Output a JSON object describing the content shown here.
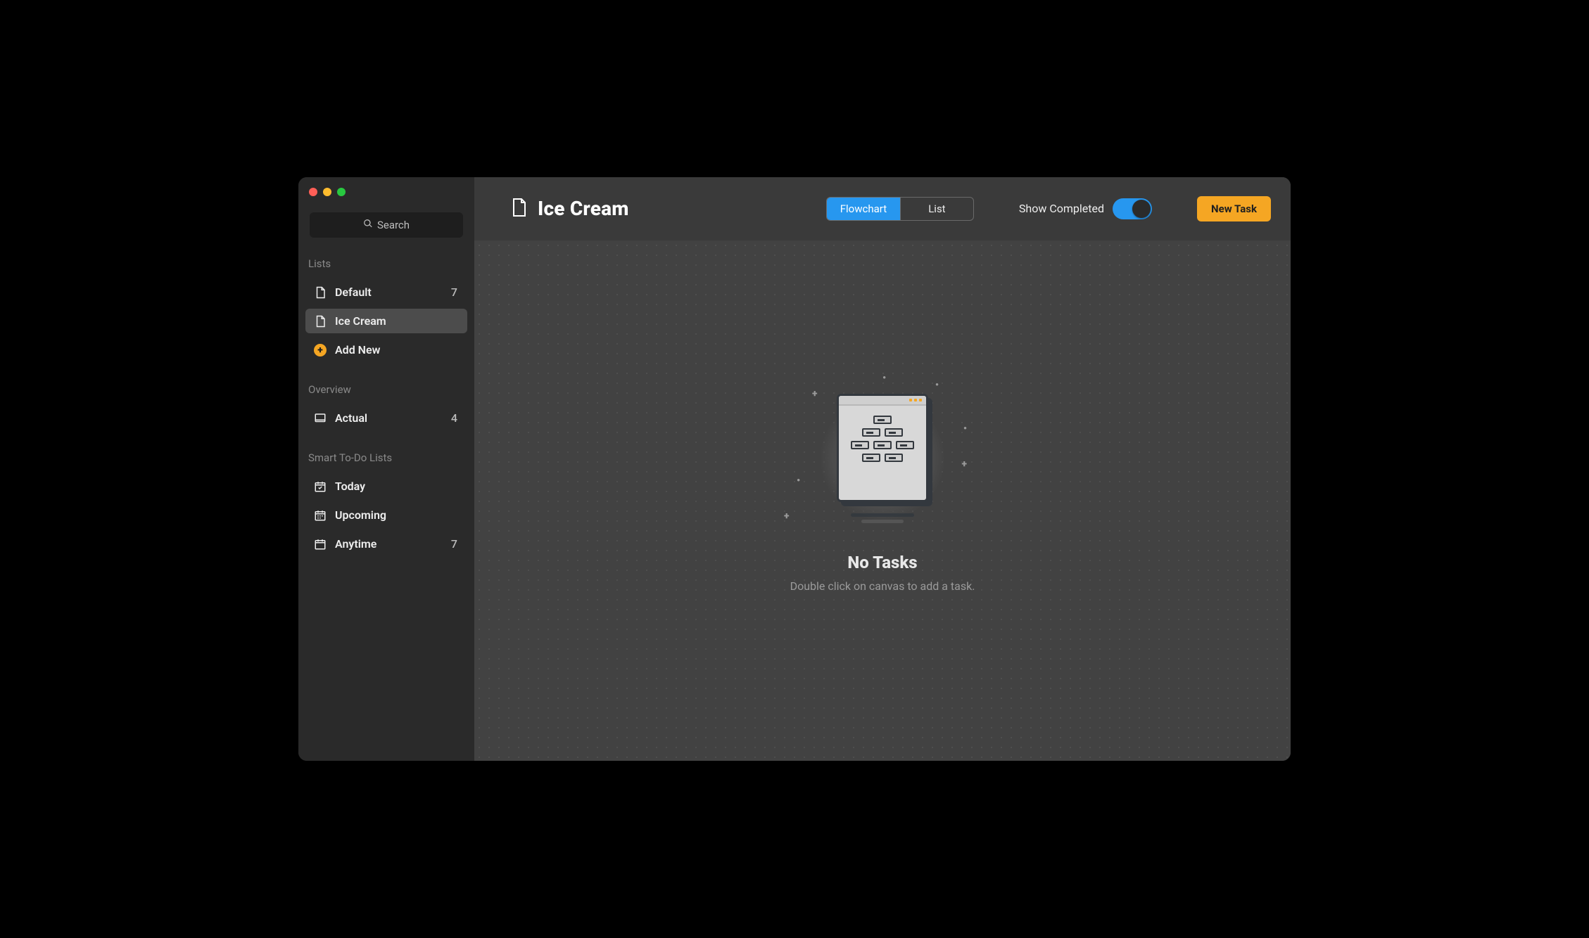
{
  "search": {
    "placeholder": "Search"
  },
  "sidebar": {
    "sections": {
      "lists": {
        "header": "Lists"
      },
      "overview": {
        "header": "Overview"
      },
      "smart": {
        "header": "Smart To-Do Lists"
      }
    },
    "lists": [
      {
        "label": "Default",
        "count": "7"
      },
      {
        "label": "Ice Cream",
        "count": ""
      }
    ],
    "add_new_label": "Add New",
    "overview": [
      {
        "label": "Actual",
        "count": "4"
      }
    ],
    "smart": [
      {
        "label": "Today",
        "count": ""
      },
      {
        "label": "Upcoming",
        "count": ""
      },
      {
        "label": "Anytime",
        "count": "7"
      }
    ]
  },
  "header": {
    "title": "Ice Cream",
    "tabs": {
      "flowchart": "Flowchart",
      "list": "List"
    },
    "show_completed_label": "Show Completed",
    "show_completed_on": true,
    "new_task_label": "New Task"
  },
  "empty": {
    "title": "No Tasks",
    "subtitle": "Double click on canvas to add a task."
  }
}
